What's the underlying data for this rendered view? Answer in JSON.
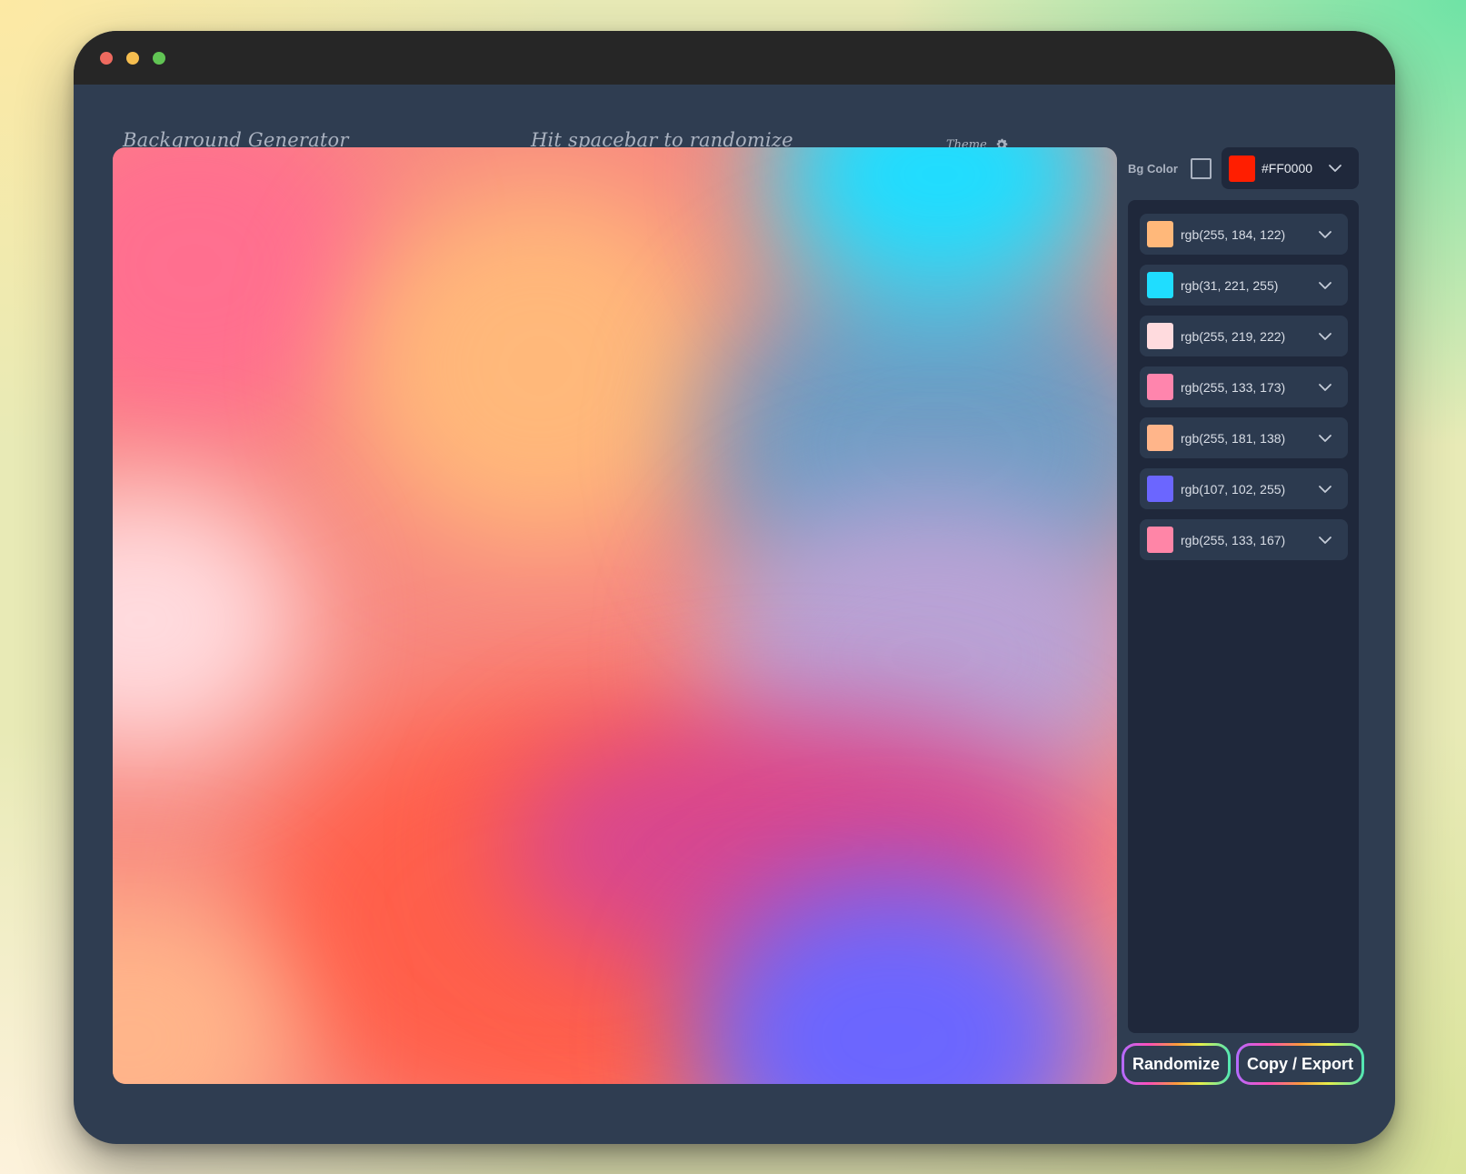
{
  "window": {
    "controls": [
      "close",
      "minimize",
      "zoom"
    ]
  },
  "header": {
    "app_title": "Background Generator",
    "hint": "Hit spacebar to randomize",
    "theme_label": "Theme",
    "theme_icon": "gear-icon"
  },
  "sidebar": {
    "bg_color_label": "Bg Color",
    "bg_color_enabled": false,
    "bg_color_value": "#FF0000",
    "bg_color_swatch": "#ff1e00",
    "colors": [
      {
        "label": "rgb(255, 184, 122)",
        "hex": "#ffb87a"
      },
      {
        "label": "rgb(31, 221, 255)",
        "hex": "#1fddff"
      },
      {
        "label": "rgb(255, 219, 222)",
        "hex": "#ffdbde"
      },
      {
        "label": "rgb(255, 133, 173)",
        "hex": "#ff85ad"
      },
      {
        "label": "rgb(255, 181, 138)",
        "hex": "#ffb58a"
      },
      {
        "label": "rgb(107, 102, 255)",
        "hex": "#6b66ff"
      },
      {
        "label": "rgb(255, 133, 167)",
        "hex": "#ff85a7"
      }
    ]
  },
  "actions": {
    "randomize_label": "Randomize",
    "export_label": "Copy / Export"
  },
  "canvas_colors": {
    "base": "#f88a80",
    "orange": "#ffb87a",
    "cyan": "#1fddff",
    "pale_pink": "#ffdbde",
    "pink": "#ff6f8f",
    "peach": "#ffb58a",
    "violet": "#6b66ff",
    "magenta": "#d8478f",
    "coral": "#ff5f4a",
    "lilac": "#b9a3d6",
    "steel_blue": "#6e9dc4"
  }
}
